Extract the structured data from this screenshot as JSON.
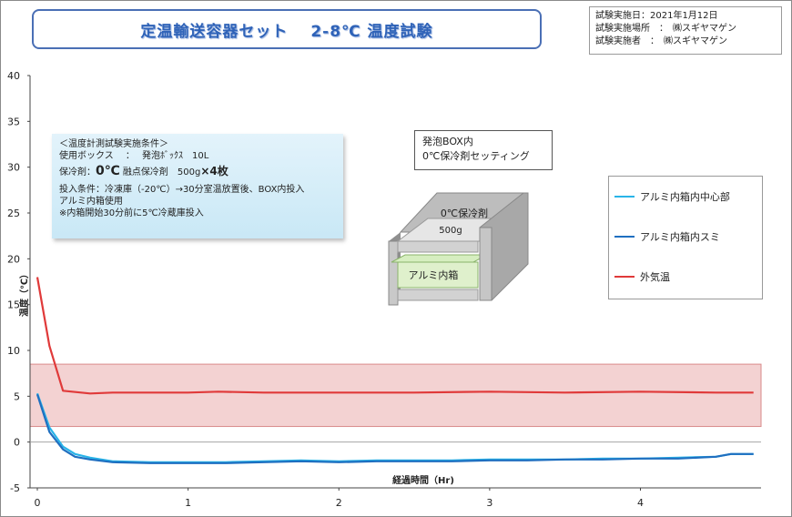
{
  "title": "定温輸送容器セット　 2-8℃ 温度試験",
  "info": {
    "line1": "試験実施日：2021年1月12日",
    "line2": "試験実施場所　：　㈱スギヤマゲン",
    "line3": "試験実施者　：　㈱スギヤマゲン"
  },
  "conditions": {
    "heading": "＜温度計測試験実施条件＞",
    "box": "使用ボックス　 ：　 発泡ﾎﾞｯｸｽ　10L",
    "coolant_prefix": "保冷剤：",
    "coolant_big": "0℃",
    "coolant_mid": " 融点保冷剤　500g",
    "coolant_count": "×4枚",
    "input1": "投入条件：冷凍庫（-20℃）→30分室温放置後、BOX内投入",
    "input2": "アルミ内箱使用",
    "input3": "※内箱開始30分前に5℃冷蔵庫投入"
  },
  "setting": {
    "line1": "発泡BOX内",
    "line2": "0℃保冷剤セッティング"
  },
  "diagram": {
    "coolant_label": "0℃保冷剤",
    "coolant_weight": "500g",
    "inner_label": "アルミ内箱"
  },
  "colors": {
    "center": "#29b4e8",
    "corner": "#1f6fc0",
    "outside": "#e03a3a",
    "band_fill": "#f3d2d2",
    "band_stroke": "#d98a8a"
  },
  "chart_data": {
    "type": "line",
    "xlabel": "経過時間（Hr)",
    "ylabel": "温度（℃）",
    "xlim": [
      0,
      4.8
    ],
    "ylim": [
      -5,
      40
    ],
    "x_ticks": [
      0,
      1,
      2,
      3,
      4
    ],
    "y_ticks": [
      40,
      35,
      30,
      25,
      20,
      15,
      10,
      5,
      0,
      -5
    ],
    "band": [
      1.7,
      8.5
    ],
    "series": [
      {
        "name": "アルミ内箱内中心部",
        "color": "#29b4e8",
        "x": [
          0,
          0.08,
          0.17,
          0.25,
          0.35,
          0.5,
          0.75,
          1.0,
          1.25,
          1.5,
          1.75,
          2.0,
          2.25,
          2.5,
          2.75,
          3.0,
          3.25,
          3.5,
          3.75,
          4.0,
          4.25,
          4.5,
          4.6,
          4.75
        ],
        "y": [
          5.3,
          1.6,
          -0.5,
          -1.3,
          -1.7,
          -2.1,
          -2.2,
          -2.2,
          -2.2,
          -2.1,
          -2.0,
          -2.1,
          -2.0,
          -2.0,
          -2.0,
          -1.9,
          -1.9,
          -1.9,
          -1.8,
          -1.8,
          -1.7,
          -1.6,
          -1.3,
          -1.3
        ]
      },
      {
        "name": "アルミ内箱内スミ",
        "color": "#1f6fc0",
        "x": [
          0,
          0.08,
          0.17,
          0.25,
          0.35,
          0.5,
          0.75,
          1.0,
          1.25,
          1.5,
          1.75,
          2.0,
          2.25,
          2.5,
          2.75,
          3.0,
          3.25,
          3.5,
          3.75,
          4.0,
          4.25,
          4.5,
          4.6,
          4.75
        ],
        "y": [
          5.2,
          1.1,
          -0.8,
          -1.6,
          -1.9,
          -2.2,
          -2.3,
          -2.3,
          -2.3,
          -2.2,
          -2.1,
          -2.2,
          -2.1,
          -2.1,
          -2.1,
          -2.0,
          -2.0,
          -1.9,
          -1.9,
          -1.8,
          -1.8,
          -1.6,
          -1.3,
          -1.3
        ]
      },
      {
        "name": "外気温",
        "color": "#e03a3a",
        "x": [
          0,
          0.08,
          0.17,
          0.35,
          0.5,
          1.0,
          1.2,
          1.5,
          2.0,
          2.5,
          3.0,
          3.5,
          4.0,
          4.5,
          4.75
        ],
        "y": [
          18,
          10.5,
          5.6,
          5.3,
          5.4,
          5.4,
          5.5,
          5.4,
          5.4,
          5.4,
          5.5,
          5.4,
          5.5,
          5.4,
          5.4
        ]
      }
    ]
  }
}
